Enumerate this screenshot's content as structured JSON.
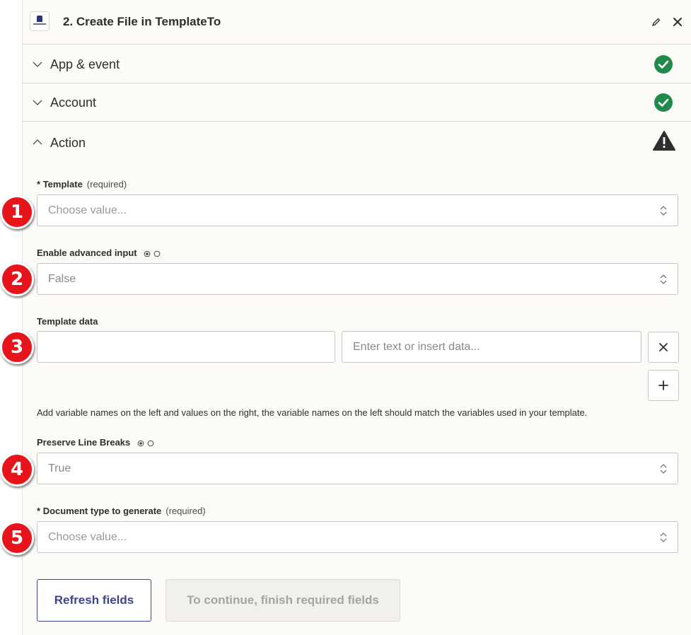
{
  "header": {
    "title": "2. Create File in TemplateTo",
    "app_icon": "templateto-logo"
  },
  "sections": [
    {
      "label": "App & event",
      "expanded": false,
      "status": "complete"
    },
    {
      "label": "Account",
      "expanded": false,
      "status": "complete"
    },
    {
      "label": "Action",
      "expanded": true,
      "status": "warning"
    }
  ],
  "fields": {
    "template": {
      "prefix": "*",
      "label": "Template",
      "required_text": "(required)",
      "placeholder": "Choose value..."
    },
    "advanced_input": {
      "label": "Enable advanced input",
      "value": "False"
    },
    "template_data": {
      "label": "Template data",
      "key_value": "",
      "value_placeholder": "Enter text or insert data...",
      "helper": "Add variable names on the left and values on the right, the variable names on the left should match the variables used in your template."
    },
    "preserve_line_breaks": {
      "label": "Preserve Line Breaks",
      "value": "True"
    },
    "document_type": {
      "prefix": "*",
      "label": "Document type to generate",
      "required_text": "(required)",
      "placeholder": "Choose value..."
    }
  },
  "buttons": {
    "refresh": "Refresh fields",
    "continue": "To continue, finish required fields"
  },
  "markers": [
    "1",
    "2",
    "3",
    "4",
    "5"
  ],
  "colors": {
    "success": "#1f8a4c",
    "warning": "#2d2e2e",
    "accent": "#3f4394",
    "marker": "#e8141b"
  }
}
